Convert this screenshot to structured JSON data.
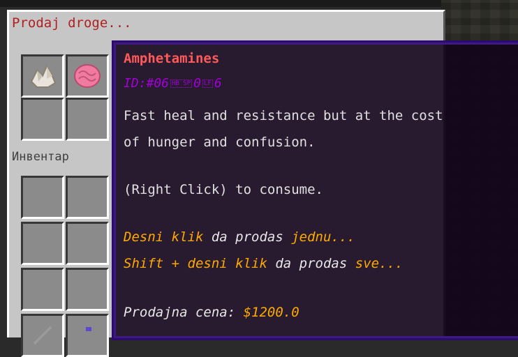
{
  "container": {
    "title": "Prodaj droge...",
    "inventory_label": "Инвентар"
  },
  "slots": {
    "sell_grid": [
      {
        "item": "crystal-icon"
      },
      {
        "item": "brain-icon"
      },
      {
        "item": "empty"
      },
      {
        "item": "empty"
      }
    ]
  },
  "tooltip": {
    "title": "Amphetamines",
    "id_prefix": "ID:#06",
    "id_glyph1": "HB SP",
    "id_mid": "0",
    "id_glyph2": "LF",
    "id_suffix": "6",
    "desc_line1": "Fast heal and resistance but at the cost",
    "desc_line2": "of hunger and confusion.",
    "consume_text": "(Right Click) to consume.",
    "sell_one_a": "Desni klik",
    "sell_one_b": " da prodas ",
    "sell_one_c": "jednu...",
    "sell_all_a": "Shift + desni klik",
    "sell_all_b": " da prodas ",
    "sell_all_c": "sve...",
    "price_label": "Prodajna cena: ",
    "price_value": "$1200.0"
  },
  "colors": {
    "title_red": "#ff5a5a",
    "id_purple": "#a300d9",
    "highlight_yellow": "#ffaa00",
    "tooltip_border": "#2d0a6e"
  }
}
